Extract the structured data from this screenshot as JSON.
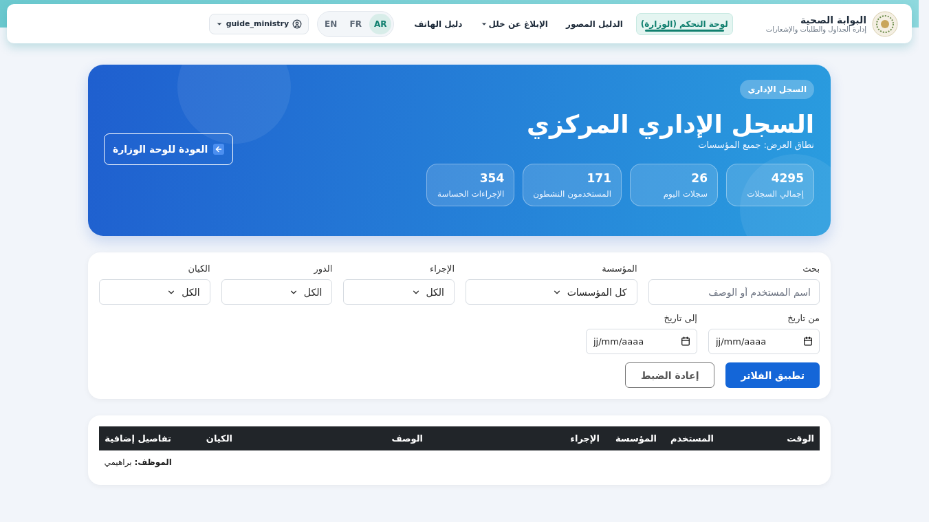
{
  "brand": {
    "title": "البوابة الصحية",
    "subtitle": "إدارة الجداول والطلبات والإشعارات"
  },
  "nav": [
    {
      "label": "لوحة التحكم (الوزارة)",
      "selected": true,
      "dropdown": false
    },
    {
      "label": "الدليل المصور",
      "selected": false,
      "dropdown": false
    },
    {
      "label": "الإبلاغ عن خلل",
      "selected": false,
      "dropdown": true
    },
    {
      "label": "دليل الهاتف",
      "selected": false,
      "dropdown": false
    }
  ],
  "languages": [
    {
      "label": "AR",
      "selected": true
    },
    {
      "label": "FR",
      "selected": false
    },
    {
      "label": "EN",
      "selected": false
    }
  ],
  "user": {
    "name": "guide_ministry"
  },
  "hero": {
    "badge": "السجل الإداري",
    "title": "السجل الإداري المركزي",
    "scope": "نطاق العرض: جميع المؤسسات",
    "back_button": "العودة للوحة الوزارة",
    "stats": [
      {
        "value": "4295",
        "label": "إجمالي السجلات"
      },
      {
        "value": "26",
        "label": "سجلات اليوم"
      },
      {
        "value": "171",
        "label": "المستخدمون النشطون"
      },
      {
        "value": "354",
        "label": "الإجراءات الحساسة"
      }
    ]
  },
  "filters": {
    "search": {
      "label": "بحث",
      "placeholder": "اسم المستخدم أو الوصف"
    },
    "selects": [
      {
        "label": "المؤسسة",
        "value": "كل المؤسسات"
      },
      {
        "label": "الإجراء",
        "value": "الكل"
      },
      {
        "label": "الدور",
        "value": "الكل"
      },
      {
        "label": "الكيان",
        "value": "الكل"
      }
    ],
    "dates": [
      {
        "label": "من تاريخ",
        "placeholder": "jj/mm/aaaa"
      },
      {
        "label": "إلى تاريخ",
        "placeholder": "jj/mm/aaaa"
      }
    ],
    "apply_button": "تطبيق الفلاتر",
    "reset_button": "إعادة الضبط"
  },
  "table": {
    "columns": [
      "الوقت",
      "المستخدم",
      "المؤسسة",
      "الإجراء",
      "الوصف",
      "الكيان",
      "تفاصيل إضافية"
    ],
    "rows": [
      [
        "",
        "",
        "",
        "",
        "",
        "",
        "**الموظف:** براهيمي"
      ]
    ]
  }
}
